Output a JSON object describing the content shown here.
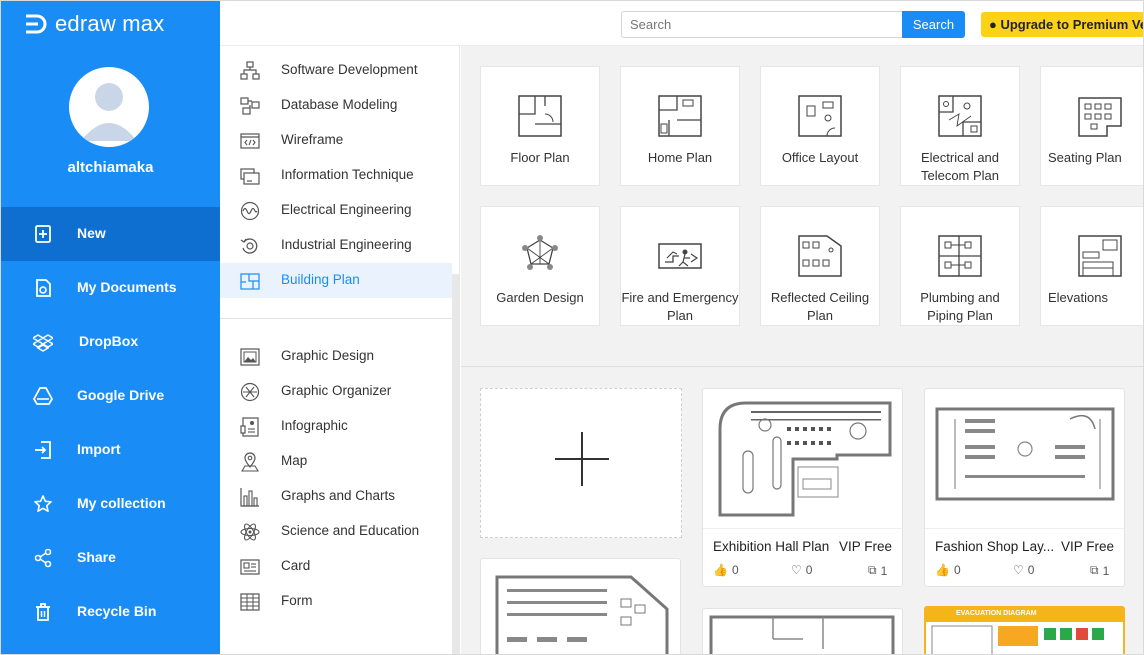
{
  "app": {
    "logo_text": "edraw max",
    "username": "altchiamaka"
  },
  "nav": {
    "items": [
      {
        "label": "New",
        "icon": "new-file-icon",
        "active": true
      },
      {
        "label": "My Documents",
        "icon": "documents-icon"
      },
      {
        "label": "DropBox",
        "icon": "dropbox-icon"
      },
      {
        "label": "Google Drive",
        "icon": "google-drive-icon"
      },
      {
        "label": "Import",
        "icon": "import-icon"
      },
      {
        "label": "My collection",
        "icon": "star-icon"
      },
      {
        "label": "Share",
        "icon": "share-icon"
      },
      {
        "label": "Recycle Bin",
        "icon": "trash-icon"
      }
    ]
  },
  "topbar": {
    "search_placeholder": "Search",
    "search_button": "Search",
    "premium_label": "Upgrade to Premium Ver"
  },
  "categories": {
    "group1": [
      {
        "label": "Software Development",
        "icon": "hierarchy-icon"
      },
      {
        "label": "Database Modeling",
        "icon": "database-icon"
      },
      {
        "label": "Wireframe",
        "icon": "code-window-icon"
      },
      {
        "label": "Information Technique",
        "icon": "computer-icon"
      },
      {
        "label": "Electrical Engineering",
        "icon": "waveform-icon"
      },
      {
        "label": "Industrial Engineering",
        "icon": "gear-cycle-icon"
      },
      {
        "label": "Building Plan",
        "icon": "floorplan-icon",
        "active": true
      }
    ],
    "group2": [
      {
        "label": "Graphic Design",
        "icon": "image-icon"
      },
      {
        "label": "Graphic Organizer",
        "icon": "organizer-icon"
      },
      {
        "label": "Infographic",
        "icon": "infographic-icon"
      },
      {
        "label": "Map",
        "icon": "map-pin-icon"
      },
      {
        "label": "Graphs and Charts",
        "icon": "bar-chart-icon"
      },
      {
        "label": "Science and Education",
        "icon": "atom-icon"
      },
      {
        "label": "Card",
        "icon": "card-icon"
      },
      {
        "label": "Form",
        "icon": "table-icon"
      }
    ]
  },
  "templates": [
    {
      "label": "Floor Plan"
    },
    {
      "label": "Home Plan"
    },
    {
      "label": "Office Layout"
    },
    {
      "label": "Electrical and Telecom Plan"
    },
    {
      "label": "Seating Plan"
    },
    {
      "label": "Garden Design"
    },
    {
      "label": "Fire and Emergency Plan"
    },
    {
      "label": "Reflected Ceiling Plan"
    },
    {
      "label": "Plumbing and Piping Plan"
    },
    {
      "label": "Elevations"
    }
  ],
  "examples": [
    {
      "title": "Exhibition Hall Plan",
      "badge": "VIP Free",
      "likes": "0",
      "favorites": "0",
      "copies": "1"
    },
    {
      "title": "Fashion Shop Lay...",
      "badge": "VIP Free",
      "likes": "0",
      "favorites": "0",
      "copies": "1"
    }
  ],
  "partial_examples": [
    {
      "title": "EVACUATION DIAGRAM"
    }
  ],
  "colors": {
    "primary": "#1a8cf5",
    "nav_active": "#0e6fd1",
    "premium": "#fcd217",
    "evacuation": "#f4b41a"
  }
}
